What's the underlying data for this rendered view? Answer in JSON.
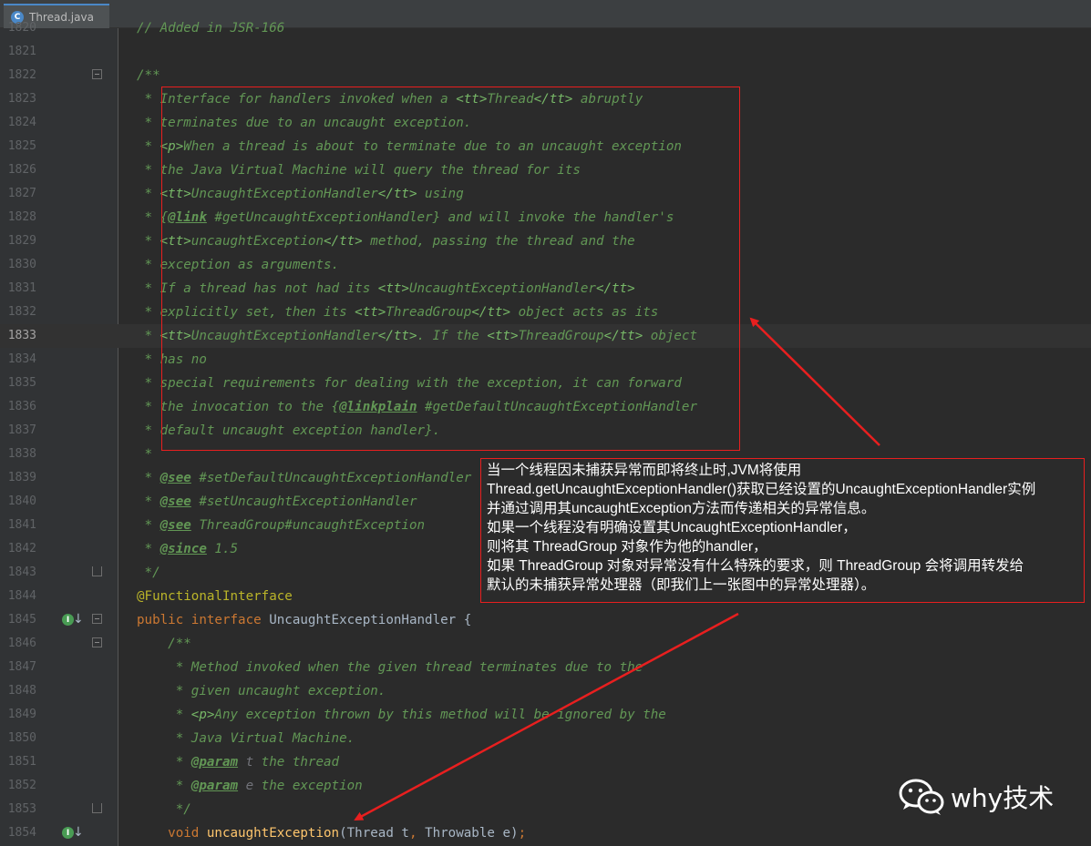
{
  "tab": {
    "icon": "C",
    "label": "Thread.java"
  },
  "lines": [
    {
      "num": "1820",
      "segments": [
        {
          "c": "cm",
          "t": "// Added in JSR-166"
        }
      ]
    },
    {
      "num": "1821",
      "segments": []
    },
    {
      "num": "1822",
      "segments": [
        {
          "c": "cm",
          "t": "/**"
        }
      ]
    },
    {
      "num": "1823",
      "segments": [
        {
          "c": "cm",
          "t": " * Interface for handlers invoked when a "
        },
        {
          "c": "tag",
          "t": "<tt>"
        },
        {
          "c": "cm",
          "t": "Thread"
        },
        {
          "c": "tag",
          "t": "</tt>"
        },
        {
          "c": "cm",
          "t": " abruptly"
        }
      ]
    },
    {
      "num": "1824",
      "segments": [
        {
          "c": "cm",
          "t": " * terminates due to an uncaught exception."
        }
      ]
    },
    {
      "num": "1825",
      "segments": [
        {
          "c": "cm",
          "t": " * "
        },
        {
          "c": "tag",
          "t": "<p>"
        },
        {
          "c": "cm",
          "t": "When a thread is about to terminate due to an uncaught exception"
        }
      ]
    },
    {
      "num": "1826",
      "segments": [
        {
          "c": "cm",
          "t": " * the Java Virtual Machine will query the thread for its"
        }
      ]
    },
    {
      "num": "1827",
      "segments": [
        {
          "c": "cm",
          "t": " * "
        },
        {
          "c": "tag",
          "t": "<tt>"
        },
        {
          "c": "cm",
          "t": "UncaughtExceptionHandler"
        },
        {
          "c": "tag",
          "t": "</tt>"
        },
        {
          "c": "cm",
          "t": " using"
        }
      ]
    },
    {
      "num": "1828",
      "segments": [
        {
          "c": "cm",
          "t": " * {"
        },
        {
          "c": "doctag",
          "t": "@link"
        },
        {
          "c": "cm",
          "t": " #getUncaughtExceptionHandler} and will invoke the handler's"
        }
      ]
    },
    {
      "num": "1829",
      "segments": [
        {
          "c": "cm",
          "t": " * "
        },
        {
          "c": "tag",
          "t": "<tt>"
        },
        {
          "c": "cm",
          "t": "uncaughtException"
        },
        {
          "c": "tag",
          "t": "</tt>"
        },
        {
          "c": "cm",
          "t": " method, passing the thread and the"
        }
      ]
    },
    {
      "num": "1830",
      "segments": [
        {
          "c": "cm",
          "t": " * exception as arguments."
        }
      ]
    },
    {
      "num": "1831",
      "segments": [
        {
          "c": "cm",
          "t": " * If a thread has not had its "
        },
        {
          "c": "tag",
          "t": "<tt>"
        },
        {
          "c": "cm",
          "t": "UncaughtExceptionHandler"
        },
        {
          "c": "tag",
          "t": "</tt>"
        }
      ]
    },
    {
      "num": "1832",
      "segments": [
        {
          "c": "cm",
          "t": " * explicitly set, then its "
        },
        {
          "c": "tag",
          "t": "<tt>"
        },
        {
          "c": "cm",
          "t": "ThreadGroup"
        },
        {
          "c": "tag",
          "t": "</tt>"
        },
        {
          "c": "cm",
          "t": " object acts as its"
        }
      ]
    },
    {
      "num": "1833",
      "current": true,
      "segments": [
        {
          "c": "cm",
          "t": " * "
        },
        {
          "c": "tag",
          "t": "<tt>"
        },
        {
          "c": "cm",
          "t": "UncaughtExceptionHandler"
        },
        {
          "c": "tag",
          "t": "</tt>"
        },
        {
          "c": "cm",
          "t": ". If the "
        },
        {
          "c": "tag",
          "t": "<tt>"
        },
        {
          "c": "cm",
          "t": "ThreadGroup"
        },
        {
          "c": "tag",
          "t": "</tt>"
        },
        {
          "c": "cm",
          "t": " object"
        }
      ]
    },
    {
      "num": "1834",
      "segments": [
        {
          "c": "cm",
          "t": " * has no"
        }
      ]
    },
    {
      "num": "1835",
      "segments": [
        {
          "c": "cm",
          "t": " * special requirements for dealing with the exception, it can forward"
        }
      ]
    },
    {
      "num": "1836",
      "segments": [
        {
          "c": "cm",
          "t": " * the invocation to the {"
        },
        {
          "c": "doctag",
          "t": "@linkplain"
        },
        {
          "c": "cm",
          "t": " #getDefaultUncaughtExceptionHandler"
        }
      ]
    },
    {
      "num": "1837",
      "segments": [
        {
          "c": "cm",
          "t": " * default uncaught exception handler}."
        }
      ]
    },
    {
      "num": "1838",
      "segments": [
        {
          "c": "cm",
          "t": " *"
        }
      ]
    },
    {
      "num": "1839",
      "segments": [
        {
          "c": "cm",
          "t": " * "
        },
        {
          "c": "doctag",
          "t": "@see"
        },
        {
          "c": "cm",
          "t": " #setDefaultUncaughtExceptionHandler"
        }
      ]
    },
    {
      "num": "1840",
      "segments": [
        {
          "c": "cm",
          "t": " * "
        },
        {
          "c": "doctag",
          "t": "@see"
        },
        {
          "c": "cm",
          "t": " #setUncaughtExceptionHandler"
        }
      ]
    },
    {
      "num": "1841",
      "segments": [
        {
          "c": "cm",
          "t": " * "
        },
        {
          "c": "doctag",
          "t": "@see"
        },
        {
          "c": "cm",
          "t": " ThreadGroup#uncaughtException"
        }
      ]
    },
    {
      "num": "1842",
      "segments": [
        {
          "c": "cm",
          "t": " * "
        },
        {
          "c": "doctag",
          "t": "@since"
        },
        {
          "c": "cm",
          "t": " 1.5"
        }
      ]
    },
    {
      "num": "1843",
      "segments": [
        {
          "c": "cm",
          "t": " */"
        }
      ]
    },
    {
      "num": "1844",
      "segments": [
        {
          "c": "ann",
          "t": "@FunctionalInterface"
        }
      ]
    },
    {
      "num": "1845",
      "segments": [
        {
          "c": "kw",
          "t": "public interface "
        },
        {
          "c": "plain",
          "t": "UncaughtExceptionHandler {"
        }
      ]
    },
    {
      "num": "1846",
      "segments": [
        {
          "c": "cm",
          "t": "    /**"
        }
      ]
    },
    {
      "num": "1847",
      "segments": [
        {
          "c": "cm",
          "t": "     * Method invoked when the given thread terminates due to the"
        }
      ]
    },
    {
      "num": "1848",
      "segments": [
        {
          "c": "cm",
          "t": "     * given uncaught exception."
        }
      ]
    },
    {
      "num": "1849",
      "segments": [
        {
          "c": "cm",
          "t": "     * "
        },
        {
          "c": "tag",
          "t": "<p>"
        },
        {
          "c": "cm",
          "t": "Any exception thrown by this method will be ignored by the"
        }
      ]
    },
    {
      "num": "1850",
      "segments": [
        {
          "c": "cm",
          "t": "     * Java Virtual Machine."
        }
      ]
    },
    {
      "num": "1851",
      "segments": [
        {
          "c": "cm",
          "t": "     * "
        },
        {
          "c": "doctag",
          "t": "@param"
        },
        {
          "c": "param",
          "t": " t"
        },
        {
          "c": "cm",
          "t": " the thread"
        }
      ]
    },
    {
      "num": "1852",
      "segments": [
        {
          "c": "cm",
          "t": "     * "
        },
        {
          "c": "doctag",
          "t": "@param"
        },
        {
          "c": "param",
          "t": " e"
        },
        {
          "c": "cm",
          "t": " the exception"
        }
      ]
    },
    {
      "num": "1853",
      "segments": [
        {
          "c": "cm",
          "t": "     */"
        }
      ]
    },
    {
      "num": "1854",
      "segments": [
        {
          "c": "kw",
          "t": "    void "
        },
        {
          "c": "fn",
          "t": "uncaughtException"
        },
        {
          "c": "plain",
          "t": "(Thread t"
        },
        {
          "c": "kw",
          "t": ", "
        },
        {
          "c": "plain",
          "t": "Throwable e)"
        },
        {
          "c": "kw",
          "t": ";"
        }
      ]
    }
  ],
  "callout": {
    "lines": [
      "当一个线程因未捕获异常而即将终止时,JVM将使用",
      "Thread.getUncaughtExceptionHandler()获取已经设置的UncaughtExceptionHandler实例",
      "并通过调用其uncaughtException方法而传递相关的异常信息。",
      "如果一个线程没有明确设置其UncaughtExceptionHandler，",
      "则将其 ThreadGroup 对象作为他的handler，",
      "如果 ThreadGroup 对象对异常没有什么特殊的要求，则 ThreadGroup 会将调用转发给",
      "默认的未捕获异常处理器（即我们上一张图中的异常处理器）。"
    ]
  },
  "watermark": {
    "text": "why技术"
  },
  "colors": {
    "annotation_red": "#e81f1f",
    "comment": "#629755",
    "keyword": "#cc7832"
  }
}
